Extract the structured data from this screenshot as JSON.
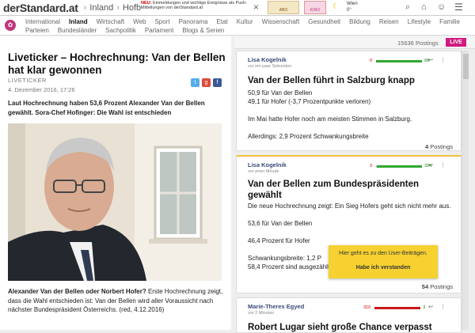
{
  "header": {
    "logo": "derStandard.at",
    "crumb_sep": "›",
    "crumbs": [
      "Inland",
      "Hofb"
    ],
    "notice_new": "NEU:",
    "notice_text": "Einmeldungen und wichtige Ereignisse als Push-Mitteilungen von derStandard.at",
    "close": "×",
    "badge1": "ABO",
    "badge2": "KINO",
    "weather_city": "Wien",
    "weather_temp": "0°"
  },
  "nav": {
    "row1": [
      "International",
      "Inland",
      "Wirtschaft",
      "Web",
      "Sport",
      "Panorama",
      "Etat",
      "Kultur",
      "Wissenschaft",
      "Gesundheit",
      "Bildung",
      "Reisen",
      "Lifestyle",
      "Familie"
    ],
    "row2": [
      "Parteien",
      "Bundesländer",
      "Sachpolitik",
      "Parlament",
      "Blogs & Serien"
    ],
    "active": "Inland"
  },
  "article": {
    "title": "Liveticker – Hochrechnung: Van der Bellen hat klar gewonnen",
    "kicker": "LIVETICKER",
    "date": "4. Dezember 2016, 17:26",
    "lead": "Laut Hochrechnung haben 53,6 Prozent Alexander Van der Bellen gewählt. Sora-Chef Hofinger: Die Wahl ist entschieden",
    "caption_bold": "Alexander Van der Bellen oder Norbert Hofer?",
    "caption": " Erste Hochrechnung zeigt, dass die Wahl entschieden ist: Van der Bellen wird aller Voraussicht nach nächster Bundespräsident Österreichs. (red, 4.12.2016)"
  },
  "postings": {
    "count": "15636 Postings",
    "live": "LIVE",
    "cards": [
      {
        "author": "Lisa Kogelnik",
        "ago": "vor ein paar Sekunden",
        "neg": "0",
        "pos": "68",
        "pos_fraction": 1.0,
        "title": "Van der Bellen führt in Salzburg knapp",
        "lines": [
          "50,9 für Van der Bellen",
          "49,1 für Hofer (-3,7 Prozentpunkte verloren)",
          "",
          "Im Mai hatte Hofer noch am meisten Stimmen in Salzburg.",
          "",
          "Allerdings: 2,9 Prozent Schwankungsbreite"
        ],
        "footer_num": "4",
        "footer_label": " Postings"
      },
      {
        "author": "Lisa Kogelnik",
        "ago": "vor einer Minute",
        "neg": "3",
        "pos": "324",
        "pos_fraction": 0.99,
        "title": "Van der Bellen zum Bundespräsidenten gewählt",
        "lines": [
          "Die neue Hochrechnung zeigt: Ein Sieg Hofers geht sich nicht mehr aus.",
          "",
          "53,6 für Van der Bellen",
          "",
          "46,4 Prozent für Hofer",
          "",
          "Schwankungsbreite: 1,2 P",
          "58,4 Prozent sind ausgezählt"
        ],
        "footer_num": "54",
        "footer_label": " Postings"
      },
      {
        "author": "Marie-Theres Egyed",
        "ago": "vor 2 Minuten",
        "neg": "310",
        "pos": "3",
        "neg_fraction": 0.99,
        "title": "Robert Lugar sieht große Chance verpasst"
      }
    ],
    "tooltip_text": "Hier geht es zu den User-Beiträgen.",
    "tooltip_button": "Habe ich verstanden"
  },
  "colors": {
    "live": "#d21a7e",
    "tooltip": "#f6d130",
    "author": "#3a4a78",
    "positive": "#2fa82f",
    "negative": "#c81818"
  }
}
